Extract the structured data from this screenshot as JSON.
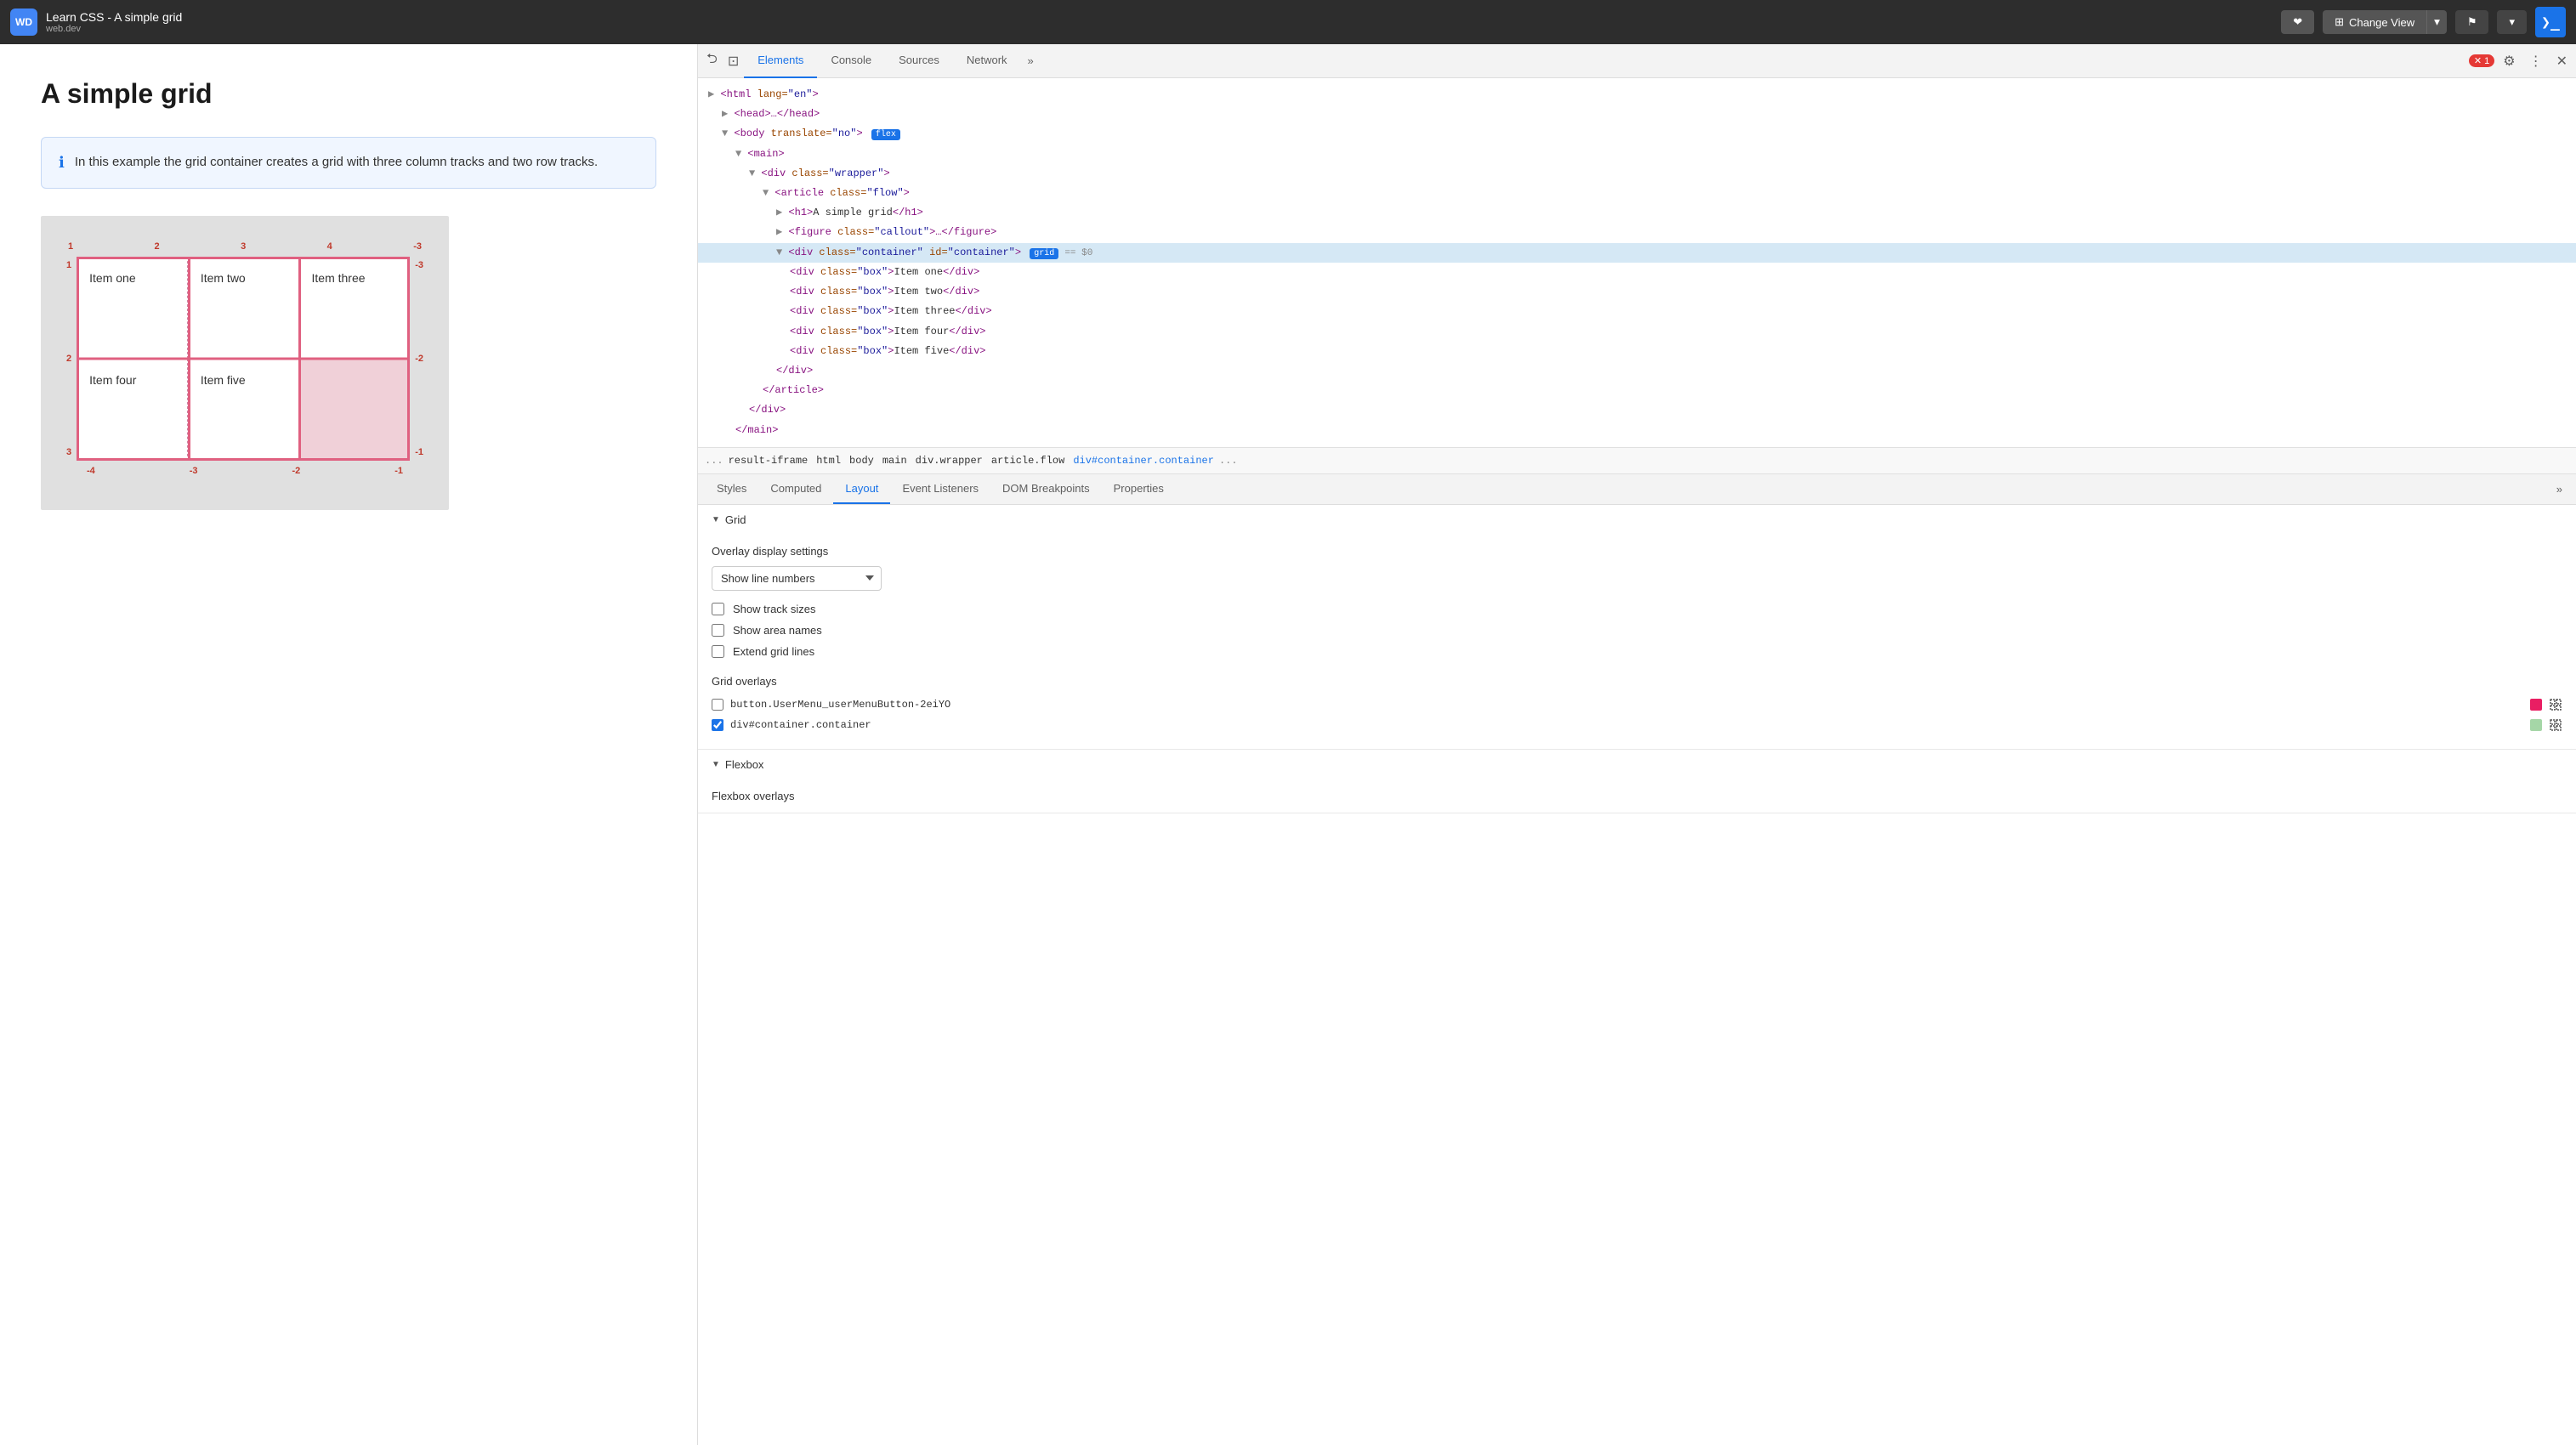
{
  "topbar": {
    "icon_label": "WD",
    "title": "Learn CSS - A simple grid",
    "subtitle": "web.dev",
    "heart_btn": "❤",
    "change_view_btn": "Change View",
    "bookmark_btn": "⚑",
    "terminal_btn": "❯"
  },
  "page": {
    "heading": "A simple grid",
    "info_text": "In this example the grid container creates a grid with three column tracks and two row tracks."
  },
  "grid_items": [
    {
      "label": "Item one",
      "empty": false
    },
    {
      "label": "Item two",
      "empty": false
    },
    {
      "label": "Item three",
      "empty": false
    },
    {
      "label": "Item four",
      "empty": false
    },
    {
      "label": "Item five",
      "empty": false
    },
    {
      "label": "",
      "empty": true
    }
  ],
  "devtools": {
    "tabs": [
      {
        "label": "Elements",
        "active": true
      },
      {
        "label": "Console",
        "active": false
      },
      {
        "label": "Sources",
        "active": false
      },
      {
        "label": "Network",
        "active": false
      }
    ],
    "tab_more": "»",
    "error_count": "1",
    "dom_lines": [
      {
        "indent": 0,
        "html": "&lt;html lang=\"en\"&gt;"
      },
      {
        "indent": 1,
        "html": "▶ &lt;head&gt;…&lt;/head&gt;"
      },
      {
        "indent": 1,
        "html": "▼ &lt;body translate=\"no\"&gt; <span class='dom-badge'>flex</span>"
      },
      {
        "indent": 2,
        "html": "▼ &lt;main&gt;"
      },
      {
        "indent": 3,
        "html": "▼ &lt;div class=\"wrapper\"&gt;"
      },
      {
        "indent": 4,
        "html": "▼ &lt;article class=\"flow\"&gt;"
      },
      {
        "indent": 5,
        "html": "▶ &lt;h1&gt;A simple grid&lt;/h1&gt;"
      },
      {
        "indent": 5,
        "html": "▶ &lt;figure class=\"callout\"&gt;…&lt;/figure&gt;"
      },
      {
        "indent": 5,
        "html": "▼ &lt;div class=\"container\" id=\"container\"&gt; <span class='dom-badge'>grid</span> == $0",
        "selected": true
      },
      {
        "indent": 6,
        "html": "&lt;div class=\"box\"&gt;Item one&lt;/div&gt;"
      },
      {
        "indent": 6,
        "html": "&lt;div class=\"box\"&gt;Item two&lt;/div&gt;"
      },
      {
        "indent": 6,
        "html": "&lt;div class=\"box\"&gt;Item three&lt;/div&gt;"
      },
      {
        "indent": 6,
        "html": "&lt;div class=\"box\"&gt;Item four&lt;/div&gt;"
      },
      {
        "indent": 6,
        "html": "&lt;div class=\"box\"&gt;Item five&lt;/div&gt;"
      },
      {
        "indent": 5,
        "html": "&lt;/div&gt;"
      },
      {
        "indent": 4,
        "html": "&lt;/article&gt;"
      },
      {
        "indent": 3,
        "html": "&lt;/div&gt;"
      },
      {
        "indent": 2,
        "html": "&lt;/main&gt;"
      }
    ],
    "breadcrumb": [
      "...",
      "result-iframe",
      "html",
      "body",
      "main",
      "div.wrapper",
      "article.flow",
      "div#container.container",
      "..."
    ],
    "panel_tabs": [
      {
        "label": "Styles",
        "active": false
      },
      {
        "label": "Computed",
        "active": false
      },
      {
        "label": "Layout",
        "active": true
      },
      {
        "label": "Event Listeners",
        "active": false
      },
      {
        "label": "DOM Breakpoints",
        "active": false
      },
      {
        "label": "Properties",
        "active": false
      }
    ],
    "layout": {
      "grid_section_label": "Grid",
      "overlay_section_label": "Overlay display settings",
      "overlay_select_value": "Show line numbers",
      "overlay_options": [
        "Show line numbers",
        "Show track sizes",
        "Show area names"
      ],
      "checkboxes": [
        {
          "label": "Show track sizes",
          "checked": false
        },
        {
          "label": "Show area names",
          "checked": false
        },
        {
          "label": "Extend grid lines",
          "checked": false
        }
      ],
      "grid_overlays_label": "Grid overlays",
      "overlay_rows": [
        {
          "label": "button.UserMenu_userMenuButton-2eiYO",
          "checked": false,
          "color": "#e91e63"
        },
        {
          "label": "div#container.container",
          "checked": true,
          "color": "#a5d6a7"
        }
      ],
      "flexbox_label": "Flexbox",
      "flexbox_overlays_label": "Flexbox overlays"
    }
  }
}
